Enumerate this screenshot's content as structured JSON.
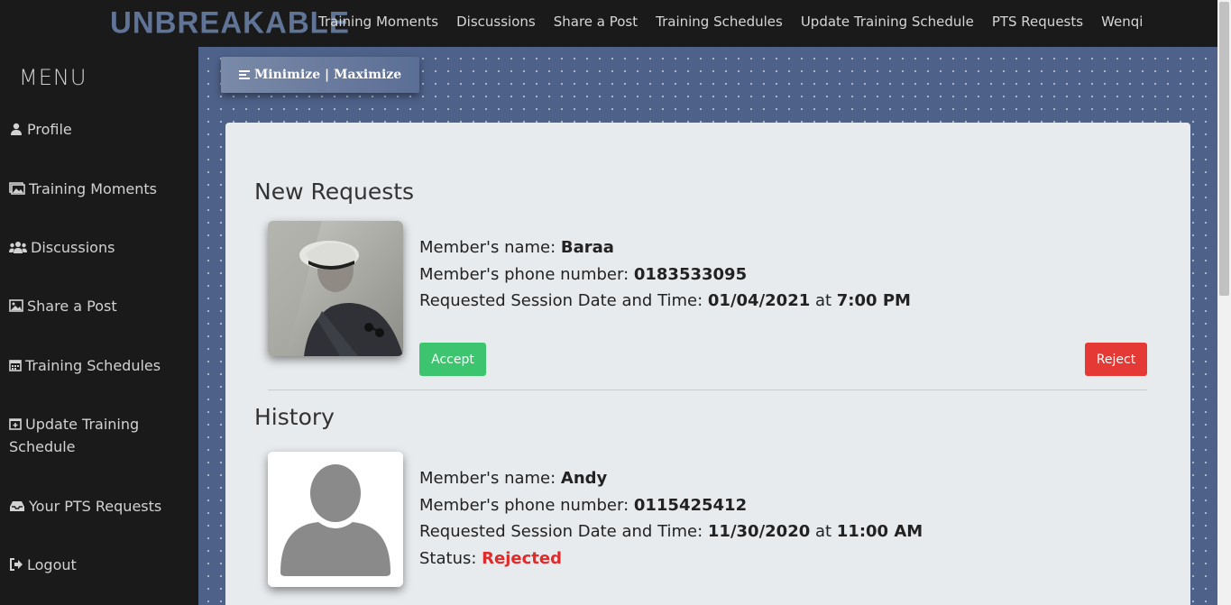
{
  "brand": {
    "logo_text": "UNBREAKABLE",
    "color": "#5f7497"
  },
  "topnav": [
    {
      "label": "Training Moments"
    },
    {
      "label": "Discussions"
    },
    {
      "label": "Share a Post"
    },
    {
      "label": "Training Schedules"
    },
    {
      "label": "Update Training Schedule"
    },
    {
      "label": "PTS Requests"
    },
    {
      "label": "Wenqi"
    }
  ],
  "sidebar": {
    "title": "MENU",
    "items": [
      {
        "label": "Profile",
        "icon": "user-icon"
      },
      {
        "label": "Training Moments",
        "icon": "images-icon"
      },
      {
        "label": "Discussions",
        "icon": "users-icon"
      },
      {
        "label": "Share a Post",
        "icon": "image-icon"
      },
      {
        "label": "Training Schedules",
        "icon": "calendar-icon"
      },
      {
        "label": "Update Training Schedule",
        "icon": "calendar-plus-icon"
      },
      {
        "label": "Your PTS Requests",
        "icon": "inbox-icon"
      },
      {
        "label": "Logout",
        "icon": "logout-icon"
      }
    ]
  },
  "toolbar": {
    "minmax_label": "Minimize | Maximize"
  },
  "new_requests": {
    "title": "New Requests",
    "name_label": "Member's name: ",
    "name": "Baraa",
    "phone_label": "Member's phone number: ",
    "phone": "0183533095",
    "datetime_label": "Requested Session Date and Time: ",
    "date": "01/04/2021",
    "at": " at ",
    "time": "7:00 PM",
    "accept_label": "Accept",
    "reject_label": "Reject"
  },
  "history": {
    "title": "History",
    "name_label": "Member's name: ",
    "name": "Andy",
    "phone_label": "Member's phone number: ",
    "phone": "0115425412",
    "datetime_label": "Requested Session Date and Time: ",
    "date": "11/30/2020",
    "at": " at ",
    "time": "11:00 AM",
    "status_label": "Status: ",
    "status": "Rejected"
  },
  "colors": {
    "accept": "#3cc46f",
    "reject": "#e53935",
    "rejected_text": "#e12a2a",
    "main_bg": "#4e6189"
  }
}
